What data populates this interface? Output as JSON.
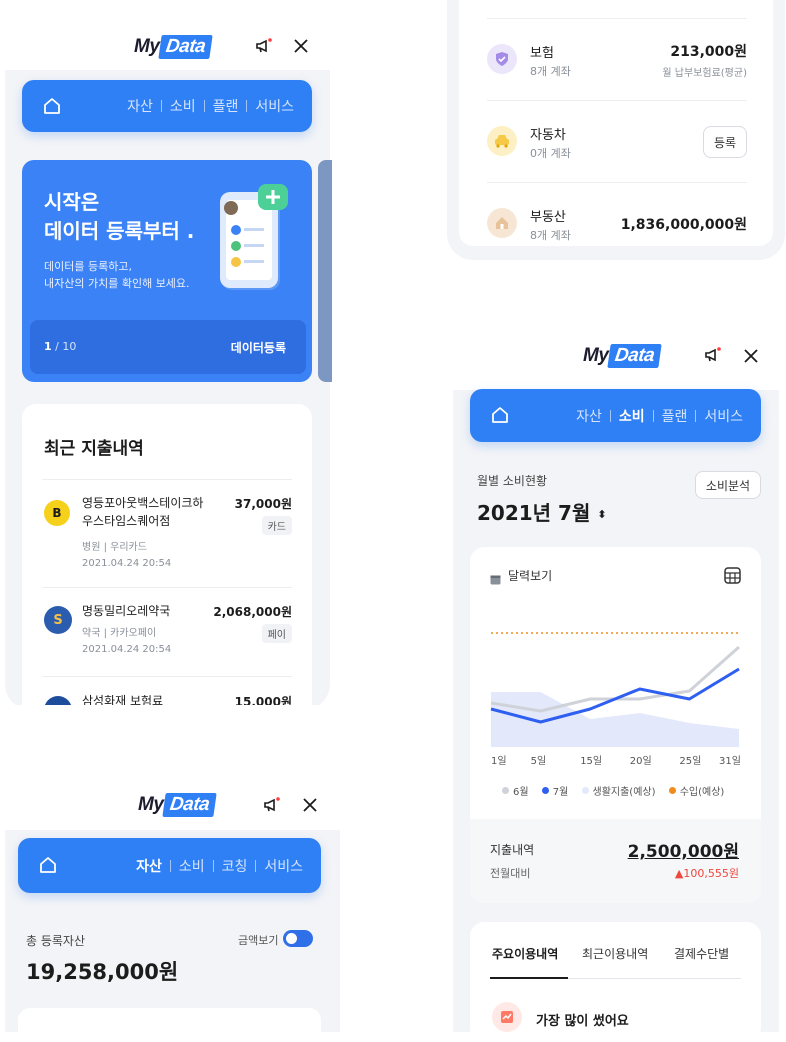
{
  "app": {
    "logo_my": "My",
    "logo_data": "Data"
  },
  "screen1": {
    "nav": {
      "tabs": [
        "자산",
        "소비",
        "플랜",
        "서비스"
      ]
    },
    "banner": {
      "title_line1": "시작은",
      "title_line2": "데이터 등록부터 .",
      "desc_line1": "데이터를 등록하고,",
      "desc_line2": "내자산의 가치를 확인해 보세요.",
      "page_current": "1",
      "page_total": "/ 10",
      "cta": "데이터등록"
    },
    "recent": {
      "title": "최근 지출내역",
      "items": [
        {
          "name_line1": "영등포아웃백스테이크하",
          "name_line2": "우스타임스퀘어점",
          "amount": "37,000원",
          "tag": "카드",
          "meta1": "병원",
          "meta2": "우리카드",
          "date": "2021.04.24 20:54",
          "logo_letter": "B"
        },
        {
          "name_line1": "명동밀리오레약국",
          "name_line2": "",
          "amount": "2,068,000원",
          "tag": "페이",
          "meta1": "약국",
          "meta2": "카카오페이",
          "date": "2021.04.24 20:54",
          "logo_letter": "S"
        },
        {
          "name_line1": "삼성화재 보험료",
          "name_line2": "",
          "amount": "15,000원",
          "tag": "",
          "meta1": "",
          "meta2": "",
          "date": "",
          "logo_letter": ""
        }
      ]
    }
  },
  "screen2": {
    "nav": {
      "tabs": [
        "자산",
        "소비",
        "코칭",
        "서비스"
      ]
    },
    "total_label": "총 등록자산",
    "amount_toggle_label": "금액보기",
    "total_value": "19,258,000원"
  },
  "screen3": {
    "items": [
      {
        "name": "보험",
        "sub": "8개 계좌",
        "value": "213,000원",
        "value_sub": "월 납부보험료(평균)",
        "icon": "shield-icon",
        "color": "#a58be8"
      },
      {
        "name": "자동차",
        "sub": "0개 계좌",
        "button": "등록",
        "icon": "car-icon",
        "color": "#f7c948"
      },
      {
        "name": "부동산",
        "sub": "8개 계좌",
        "value": "1,836,000,000원",
        "icon": "house-icon",
        "color": "#e8c29b"
      }
    ]
  },
  "screen4": {
    "nav": {
      "tabs": [
        "자산",
        "소비",
        "플랜",
        "서비스"
      ]
    },
    "monthly_label": "월별 소비현황",
    "month": "2021년 7월",
    "analysis_button": "소비분석",
    "calendar_label": "달력보기",
    "chart_data": {
      "type": "line",
      "x": [
        "1일",
        "5일",
        "15일",
        "20일",
        "25일",
        "31일"
      ],
      "series": [
        {
          "name": "6월",
          "color": "#cfd2d8",
          "values": [
            44,
            36,
            48,
            48,
            56,
            100
          ]
        },
        {
          "name": "7월",
          "color": "#2f5ff0",
          "values": [
            38,
            25,
            38,
            58,
            48,
            78
          ]
        },
        {
          "name": "생활지출(예상)",
          "color": "#e3e9fb",
          "values": [
            55,
            55,
            28,
            34,
            24,
            18
          ]
        },
        {
          "name": "수입(예상)",
          "color": "#f28b1e",
          "values": [
            114,
            114,
            114,
            114,
            114,
            114
          ]
        }
      ]
    },
    "spend_label": "지출내역",
    "spend_value": "2,500,000원",
    "compare_label": "전월대비",
    "compare_value": "▲100,555원",
    "tabs": [
      "주요이용내역",
      "최근이용내역",
      "결제수단별"
    ],
    "most_used_label": "가장 많이 썼어요"
  }
}
